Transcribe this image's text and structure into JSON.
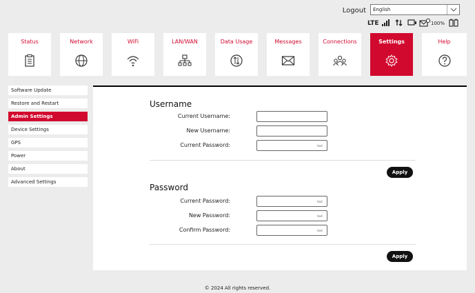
{
  "header": {
    "logout_label": "Logout",
    "language_value": "English",
    "network_type": "LTE",
    "battery_percent": "100%"
  },
  "nav": {
    "items": [
      {
        "label": "Status",
        "icon": "clipboard-icon"
      },
      {
        "label": "Network",
        "icon": "globe-icon"
      },
      {
        "label": "WiFi",
        "icon": "wifi-icon"
      },
      {
        "label": "LAN/WAN",
        "icon": "lan-icon"
      },
      {
        "label": "Data Usage",
        "icon": "data-usage-icon"
      },
      {
        "label": "Messages",
        "icon": "envelope-icon"
      },
      {
        "label": "Connections",
        "icon": "users-icon"
      },
      {
        "label": "Settings",
        "icon": "gear-icon",
        "active": true
      },
      {
        "label": "Help",
        "icon": "question-icon"
      }
    ]
  },
  "sidebar": {
    "items": [
      {
        "label": "Software Update"
      },
      {
        "label": "Restore and Restart"
      },
      {
        "label": "Admin Settings",
        "active": true
      },
      {
        "label": "Device Settings"
      },
      {
        "label": "GPS"
      },
      {
        "label": "Power"
      },
      {
        "label": "About"
      },
      {
        "label": "Advanced Settings"
      }
    ]
  },
  "username_section": {
    "title": "Username",
    "fields": [
      {
        "label": "Current Username:",
        "value": ""
      },
      {
        "label": "New Username:",
        "value": ""
      },
      {
        "label": "Current Password:",
        "value": "",
        "eye": "text"
      }
    ],
    "apply_label": "Apply"
  },
  "password_section": {
    "title": "Password",
    "fields": [
      {
        "label": "Current Password:",
        "value": "",
        "eye": "text"
      },
      {
        "label": "New Password:",
        "value": "",
        "eye": "text"
      },
      {
        "label": "Confirm Password:",
        "value": "",
        "eye": "text"
      }
    ],
    "apply_label": "Apply"
  },
  "footer": {
    "text": "© 2024 All rights reserved."
  },
  "colors": {
    "accent": "#d2092f",
    "background": "#ececec",
    "apply_button": "#111111"
  }
}
